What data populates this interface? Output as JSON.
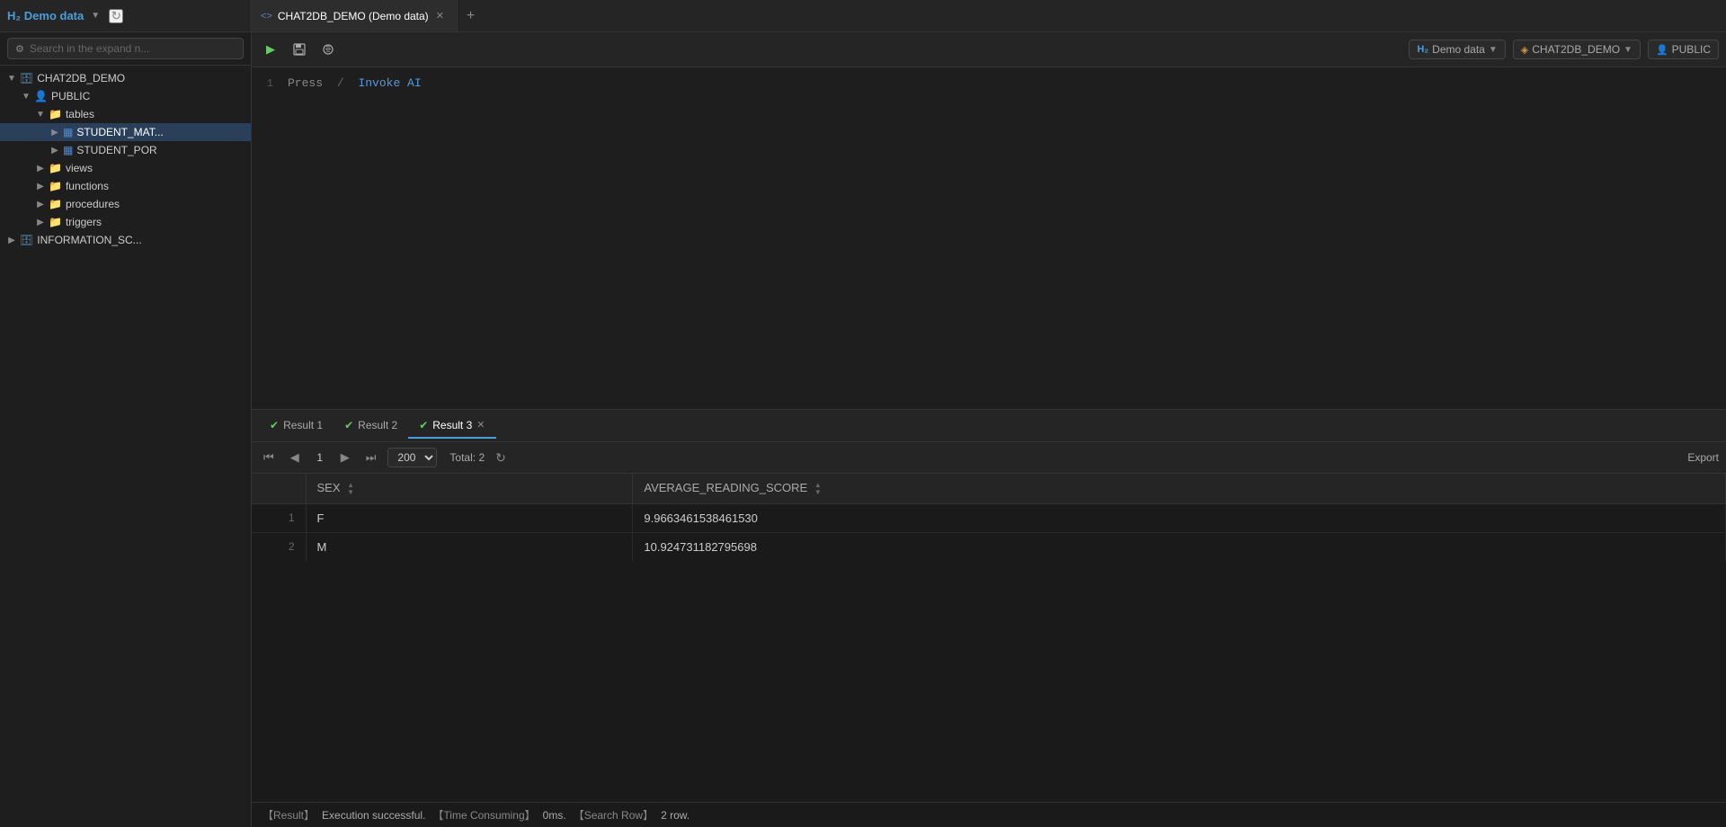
{
  "titlebar": {
    "connection": "H₂ Demo data",
    "chevron": "▼"
  },
  "tabs": [
    {
      "id": "tab1",
      "icon": "<>",
      "label": "CHAT2DB_DEMO (Demo data)",
      "closable": true,
      "active": true
    }
  ],
  "tab_add": "+",
  "connection_info": {
    "db_icon": "H₂",
    "db_name": "Demo data",
    "schema_name": "CHAT2DB_DEMO",
    "user_name": "PUBLIC"
  },
  "toolbar": {
    "play": "▶",
    "save": "💾",
    "format": "⌥"
  },
  "editor": {
    "line1_num": "1",
    "line1_press": "Press",
    "line1_slash": "/",
    "line1_invoke": "Invoke AI"
  },
  "sidebar": {
    "search_placeholder": "Search in the expand n...",
    "tree": [
      {
        "id": "db1",
        "level": 1,
        "label": "CHAT2DB_DEMO",
        "icon": "db",
        "expanded": true,
        "chevron": "open"
      },
      {
        "id": "schema1",
        "level": 2,
        "label": "PUBLIC",
        "icon": "schema",
        "expanded": true,
        "chevron": "open"
      },
      {
        "id": "tables_node",
        "level": 3,
        "label": "tables",
        "icon": "folder",
        "expanded": true,
        "chevron": "open"
      },
      {
        "id": "table1",
        "level": 4,
        "label": "STUDENT_MAT...",
        "icon": "table",
        "expanded": false,
        "chevron": "closed",
        "selected": true
      },
      {
        "id": "table2",
        "level": 4,
        "label": "STUDENT_POR",
        "icon": "table",
        "expanded": false,
        "chevron": "closed",
        "selected": false
      },
      {
        "id": "views_node",
        "level": 3,
        "label": "views",
        "icon": "folder",
        "expanded": false,
        "chevron": "closed"
      },
      {
        "id": "functions_node",
        "level": 3,
        "label": "functions",
        "icon": "folder",
        "expanded": false,
        "chevron": "closed"
      },
      {
        "id": "procedures_node",
        "level": 3,
        "label": "procedures",
        "icon": "folder",
        "expanded": false,
        "chevron": "closed"
      },
      {
        "id": "triggers_node",
        "level": 3,
        "label": "triggers",
        "icon": "folder",
        "expanded": false,
        "chevron": "closed"
      },
      {
        "id": "db2",
        "level": 1,
        "label": "INFORMATION_SC...",
        "icon": "db",
        "expanded": false,
        "chevron": "closed"
      }
    ]
  },
  "result_tabs": [
    {
      "id": "r1",
      "label": "Result 1",
      "active": false,
      "closable": false
    },
    {
      "id": "r2",
      "label": "Result 2",
      "active": false,
      "closable": false
    },
    {
      "id": "r3",
      "label": "Result 3",
      "active": true,
      "closable": true
    }
  ],
  "table_nav": {
    "first": "⏮",
    "prev": "◀",
    "page": "1",
    "next": "▶",
    "last": "⏭",
    "page_size": "200",
    "total_label": "Total:",
    "total_count": "2",
    "export_label": "Export"
  },
  "columns": [
    {
      "id": "rownum",
      "label": "",
      "sortable": false
    },
    {
      "id": "sex",
      "label": "SEX",
      "sortable": true
    },
    {
      "id": "avg_score",
      "label": "AVERAGE_READING_SCORE",
      "sortable": true
    }
  ],
  "rows": [
    {
      "rownum": "1",
      "sex": "F",
      "avg_score": "9.9663461538461530"
    },
    {
      "rownum": "2",
      "sex": "M",
      "avg_score": "10.924731182795698"
    }
  ],
  "status_bar": {
    "result_label": "【Result】",
    "result_value": "Execution successful.",
    "time_label": "【Time Consuming】",
    "time_value": "0ms.",
    "search_label": "【Search Row】",
    "search_value": "2 row."
  }
}
